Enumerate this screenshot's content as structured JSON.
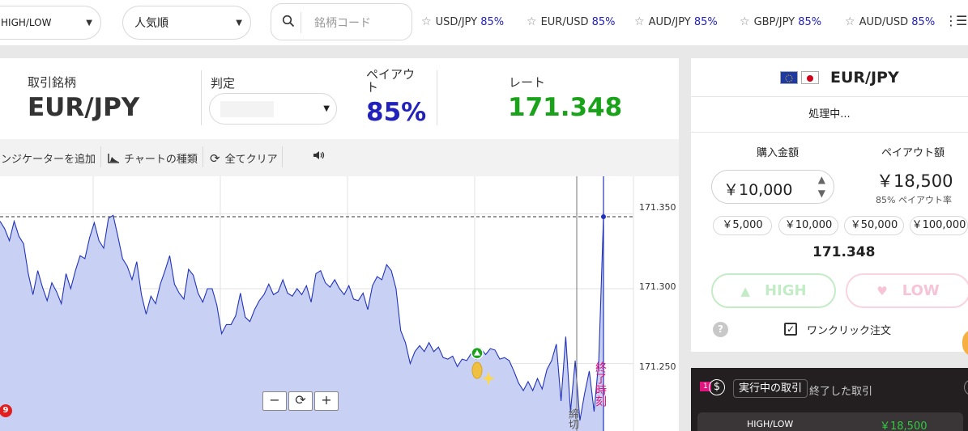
{
  "topbar": {
    "trade_type": "HIGH/LOW",
    "sort": "人気順",
    "search_placeholder": "銘柄コード",
    "favorites": [
      {
        "pair": "USD/JPY",
        "payout": "85%"
      },
      {
        "pair": "EUR/USD",
        "payout": "85%"
      },
      {
        "pair": "AUD/JPY",
        "payout": "85%"
      },
      {
        "pair": "GBP/JPY",
        "payout": "85%"
      },
      {
        "pair": "AUD/USD",
        "payout": "85%"
      }
    ]
  },
  "info": {
    "symbol_label": "取引銘柄",
    "symbol": "EUR/JPY",
    "judge_label": "判定",
    "payout_label": "ペイアウト",
    "payout": "85%",
    "rate_label": "レート",
    "rate": "171.348",
    "colors": {
      "payout": "#2222bb",
      "rate": "#1aa31a"
    }
  },
  "toolbar": {
    "indicator": "インジケーターを追加",
    "chart_type": "チャートの種類",
    "clear_all": "全てクリア"
  },
  "chart_data": {
    "type": "area",
    "ylim": [
      171.205,
      171.375
    ],
    "yticks": [
      "171.350",
      "171.300",
      "171.250"
    ],
    "reference_line": 171.348,
    "values": [
      171.345,
      171.34,
      171.332,
      171.345,
      171.335,
      171.33,
      171.31,
      171.296,
      171.312,
      171.301,
      171.292,
      171.304,
      171.298,
      171.29,
      171.31,
      171.3,
      171.312,
      171.322,
      171.32,
      171.334,
      171.344,
      171.332,
      171.327,
      171.347,
      171.349,
      171.335,
      171.32,
      171.315,
      171.306,
      171.318,
      171.296,
      171.283,
      171.295,
      171.29,
      171.303,
      171.312,
      171.322,
      171.303,
      171.297,
      171.293,
      171.313,
      171.309,
      171.297,
      171.291,
      171.3,
      171.3,
      171.289,
      171.27,
      171.276,
      171.276,
      171.282,
      171.297,
      171.281,
      171.278,
      171.286,
      171.292,
      171.296,
      171.303,
      171.296,
      171.298,
      171.306,
      171.297,
      171.295,
      171.3,
      171.296,
      171.302,
      171.291,
      171.31,
      171.312,
      171.304,
      171.301,
      171.306,
      171.3,
      171.296,
      171.302,
      171.293,
      171.292,
      171.297,
      171.286,
      171.302,
      171.308,
      171.306,
      171.316,
      171.312,
      171.3,
      171.272,
      171.264,
      171.25,
      171.258,
      171.262,
      171.258,
      171.264,
      171.258,
      171.261,
      171.254,
      171.253,
      171.255,
      171.248,
      171.253,
      171.252,
      171.257,
      171.253,
      171.26,
      171.256,
      171.26,
      171.259,
      171.253,
      171.254,
      171.252,
      171.245,
      171.237,
      171.232,
      171.238,
      171.232,
      171.24,
      171.233,
      171.246,
      171.252,
      171.263,
      171.225,
      171.268,
      171.218,
      171.252,
      171.212,
      171.23,
      171.245,
      171.218,
      171.252,
      171.348
    ],
    "markers": [
      {
        "type": "high-entry",
        "value": 171.257
      }
    ]
  },
  "chart_labels": {
    "deadline": "締切",
    "expiry": "終了時刻",
    "notifications": "9"
  },
  "order": {
    "pair": "EUR/JPY",
    "status": "処理中...",
    "amount_label": "購入金額",
    "amount": "￥10,000",
    "payout_label": "ペイアウト額",
    "payout_amount": "￥18,500",
    "payout_rate": "85% ペイアウト率",
    "presets": [
      "￥5,000",
      "￥10,000",
      "￥50,000",
      "￥100,000"
    ],
    "rate": "171.348",
    "high": "HIGH",
    "low": "LOW",
    "one_click": "ワンクリック注文",
    "help": "?"
  },
  "trades": {
    "count": "1",
    "active_tab": "実行中の取引",
    "closed_tab": "終了した取引",
    "row_type": "HIGH/LOW",
    "row_amount": "￥18,500"
  }
}
